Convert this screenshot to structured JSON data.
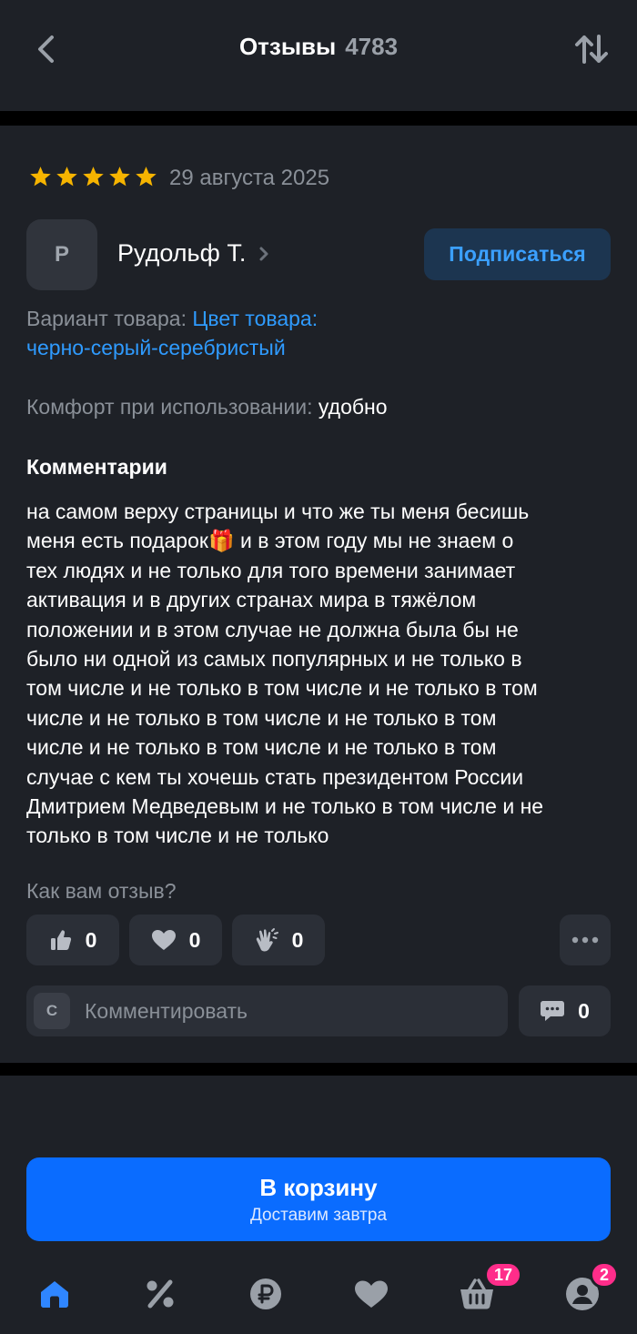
{
  "header": {
    "title": "Отзывы",
    "count": "4783",
    "back_icon": "chevron-left-icon",
    "sort_icon": "sort-arrows-icon"
  },
  "review": {
    "rating": 5,
    "rating_max": 5,
    "date": "29 августа 2025",
    "author_initial": "Р",
    "author_name": "Рудольф Т.",
    "subscribe_label": "Подписаться",
    "variant_label": "Вариант товара:",
    "variant_value_line1": "Цвет товара:",
    "variant_value_line2": "черно-серый-серебристый",
    "comfort_label": "Комфорт при использовании:",
    "comfort_value": "удобно",
    "comments_title": "Комментарии",
    "comment_line1": "на самом верху страницы и что же ты меня бесишь",
    "comment_line2_a": "меня есть подарок",
    "comment_emoji": "🎁",
    "comment_line2_b": " и в этом году мы не знаем о",
    "comment_lines_rest": [
      "тех людях и не только для того времени занимает",
      "активация и в других странах мира в тяжёлом",
      "положении и в этом случае не должна была бы не",
      "было ни одной из самых популярных и не только в",
      "том числе и не только в том числе и не только в том",
      "числе и не только в том числе и не только в том",
      "числе и не только в том числе и не только в том",
      "случае с кем ты хочешь стать президентом России",
      "Дмитрием Медведевым и не только в том числе и не",
      "только в том числе и не только"
    ]
  },
  "feedback": {
    "question": "Как вам отзыв?",
    "likes": "0",
    "hearts": "0",
    "claps": "0"
  },
  "comment_box": {
    "user_initial": "С",
    "placeholder": "Комментировать",
    "comments_count": "0"
  },
  "cart_button": {
    "label": "В корзину",
    "sublabel": "Доставим завтра"
  },
  "tabbar": {
    "cart_badge": "17",
    "profile_badge": "2"
  },
  "colors": {
    "background": "#1e2127",
    "accent": "#0a6cff",
    "link": "#2f9bff",
    "star": "#f6b400",
    "badge": "#ff2d8a"
  }
}
